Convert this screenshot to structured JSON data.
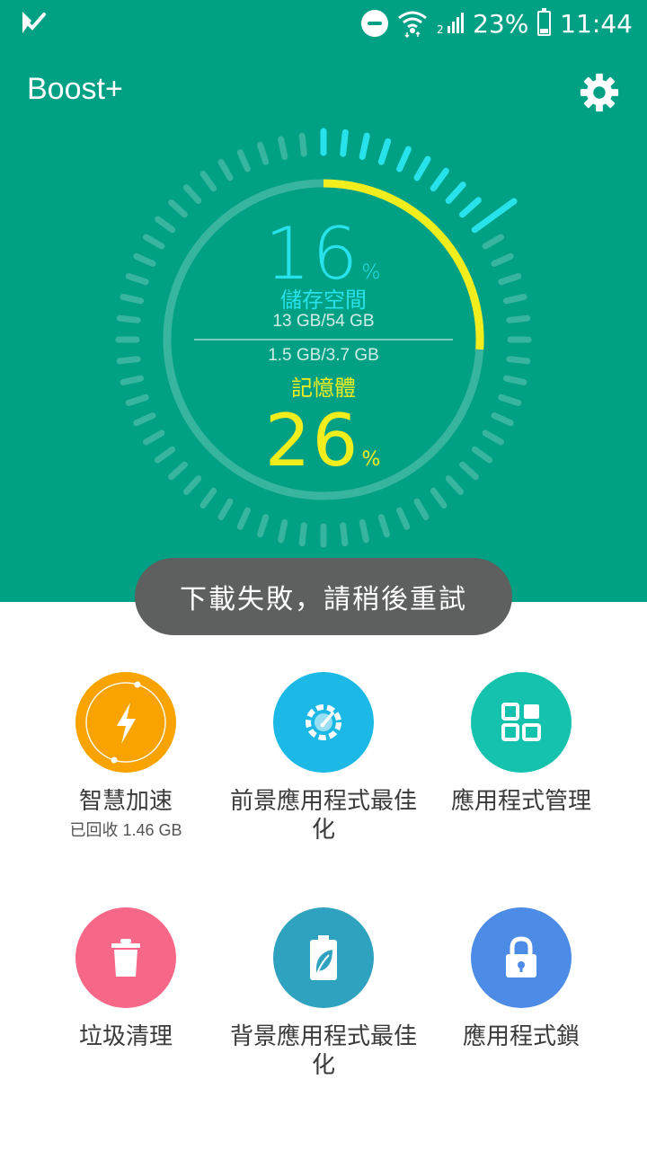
{
  "status_bar": {
    "battery_percent": "23%",
    "time": "11:44",
    "icons": [
      "app-check-icon",
      "do-not-disturb-icon",
      "wifi-icon",
      "signal-icon",
      "battery-icon"
    ]
  },
  "header": {
    "title": "Boost+",
    "settings_icon": "gear-icon"
  },
  "gauge": {
    "storage_percent": "16",
    "storage_percent_value": 16,
    "percent_sign": "%",
    "storage_label": "儲存空間",
    "storage_size": "13 GB/54 GB",
    "memory_size": "1.5 GB/3.7 GB",
    "memory_label": "記憶體",
    "memory_percent": "26",
    "memory_percent_value": 26
  },
  "toast": {
    "message": "下載失敗，請稍後重試"
  },
  "actions": [
    {
      "label": "智慧加速",
      "sub": "已回收 1.46 GB",
      "icon": "lightning-icon",
      "color": "#f8a300"
    },
    {
      "label": "前景應用程式最佳化",
      "icon": "speedometer-icon",
      "color": "#1cb9e6"
    },
    {
      "label": "應用程式管理",
      "icon": "app-grid-icon",
      "color": "#14c2ad"
    },
    {
      "label": "垃圾清理",
      "icon": "trash-icon",
      "color": "#f76787"
    },
    {
      "label": "背景應用程式最佳化",
      "icon": "battery-leaf-icon",
      "color": "#2fa2c0"
    },
    {
      "label": "應用程式鎖",
      "icon": "lock-icon",
      "color": "#4d8ce6"
    }
  ],
  "colors": {
    "header_bg": "#00a085",
    "storage_accent": "#27e2ea",
    "memory_accent": "#f2ee1e"
  }
}
